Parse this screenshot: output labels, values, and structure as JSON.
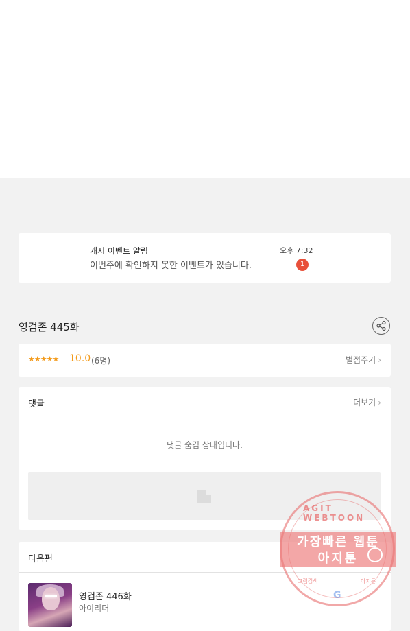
{
  "notification": {
    "title": "캐시 이벤트 알림",
    "message": "이번주에 확인하지 못한 이벤트가 있습니다.",
    "time": "오후 7:32",
    "badge_count": "1"
  },
  "episode": {
    "title": "영검존 445화",
    "share_icon": "share-icon"
  },
  "rating": {
    "stars": "★★★★★",
    "score": "10.0",
    "count": "(6명)",
    "rate_link": "별점주기"
  },
  "comments": {
    "title": "댓글",
    "more_link": "더보기",
    "hidden_notice": "댓글 숨김 상태입니다."
  },
  "next_episode": {
    "header": "다음편",
    "title": "영검존 446화",
    "author": "아이리더"
  },
  "watermark": {
    "arc_text": "AGIT WEBTOON",
    "line1": "가장빠른 웹툰",
    "line2": "아지툰",
    "bottom_left": "그림검색",
    "bottom_right": "아지툰",
    "logo": "G",
    "color": "#e86e6e"
  },
  "colors": {
    "accent": "#f39a1a",
    "badge": "#e8503a",
    "background": "#f2f2f2"
  }
}
